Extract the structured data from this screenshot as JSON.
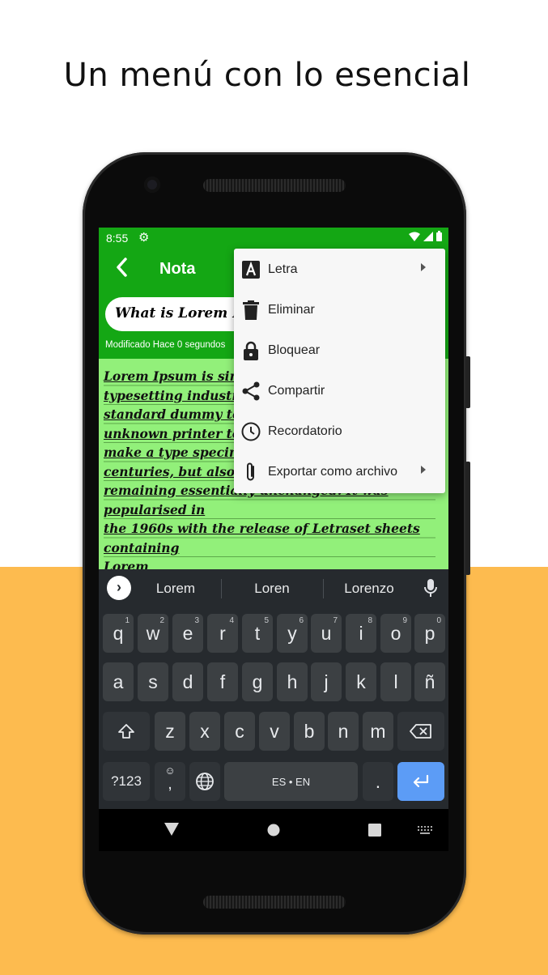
{
  "headline": "Un menú con lo esencial",
  "status_bar": {
    "time": "8:55"
  },
  "app_bar": {
    "title": "Nota"
  },
  "note": {
    "title": "What is Lorem Ipsum",
    "modified": "Modificado Hace 0 segundos",
    "body_lines": [
      "Lorem Ipsum is simply",
      "typesetting industry. I",
      "standard dummy text",
      "unknown printer took",
      "make a type specimen",
      "centuries, but also the",
      "remaining essentially unchanged. It was popularised in",
      "the 1960s with the release of Letraset sheets containing",
      "Lorem"
    ]
  },
  "menu": {
    "items": [
      {
        "label": "Letra",
        "icon": "font-icon",
        "submenu": true
      },
      {
        "label": "Eliminar",
        "icon": "trash-icon",
        "submenu": false
      },
      {
        "label": "Bloquear",
        "icon": "lock-icon",
        "submenu": false
      },
      {
        "label": "Compartir",
        "icon": "share-icon",
        "submenu": false
      },
      {
        "label": "Recordatorio",
        "icon": "clock-icon",
        "submenu": false
      },
      {
        "label": "Exportar como archivo",
        "icon": "paperclip-icon",
        "submenu": true
      }
    ]
  },
  "keyboard": {
    "suggestions": [
      "Lorem",
      "Loren",
      "Lorenzo"
    ],
    "row1": [
      {
        "k": "q",
        "s": "1"
      },
      {
        "k": "w",
        "s": "2"
      },
      {
        "k": "e",
        "s": "3"
      },
      {
        "k": "r",
        "s": "4"
      },
      {
        "k": "t",
        "s": "5"
      },
      {
        "k": "y",
        "s": "6"
      },
      {
        "k": "u",
        "s": "7"
      },
      {
        "k": "i",
        "s": "8"
      },
      {
        "k": "o",
        "s": "9"
      },
      {
        "k": "p",
        "s": "0"
      }
    ],
    "row2": [
      "a",
      "s",
      "d",
      "f",
      "g",
      "h",
      "j",
      "k",
      "l",
      "ñ"
    ],
    "row3": [
      "z",
      "x",
      "c",
      "v",
      "b",
      "n",
      "m"
    ],
    "symbols_key": "?123",
    "comma_key": ",",
    "space_label": "ES • EN",
    "period_key": ".",
    "accent_color": "#5c9cf6"
  },
  "colors": {
    "primary": "#14a714",
    "note_bg": "#92f07a",
    "page_accent": "#fdbb4f"
  }
}
